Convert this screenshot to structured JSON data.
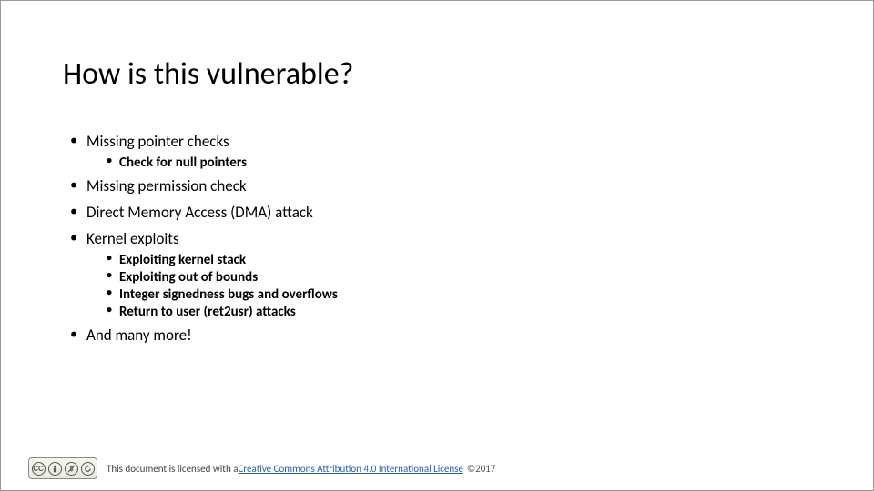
{
  "title": "How is this vulnerable?",
  "bullets": {
    "b1": "Missing pointer checks",
    "b1_sub1": "Check for null pointers",
    "b2": "Missing permission check",
    "b3": "Direct Memory Access (DMA) attack",
    "b4": "Kernel exploits",
    "b4_sub1": "Exploiting kernel stack",
    "b4_sub2": "Exploiting out of bounds",
    "b4_sub3": "Integer signedness bugs and overflows",
    "b4_sub4": "Return to user (ret2usr) attacks",
    "b5": "And many more!"
  },
  "footer": {
    "cc_letters": "CC",
    "cc_by": "BY",
    "cc_nc": "NC",
    "cc_sa": "SA",
    "prefix": "This document is licensed with a ",
    "link": "Creative Commons Attribution 4.0 International License",
    "copyright": "©2017"
  }
}
